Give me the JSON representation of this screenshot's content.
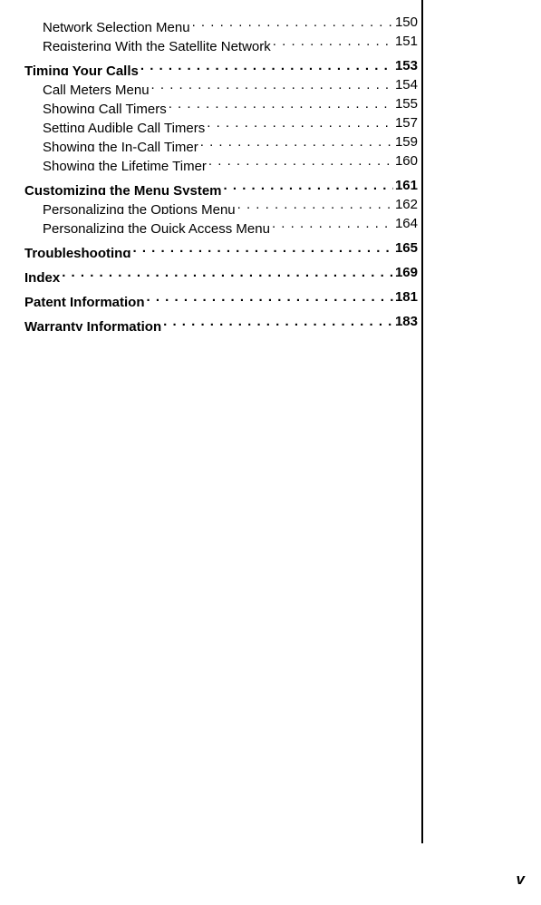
{
  "toc": [
    {
      "label": "Network Selection Menu",
      "page": "150",
      "sub": true,
      "bold": false,
      "continue": true
    },
    {
      "label": "Registering With the Satellite Network",
      "page": "151",
      "sub": true,
      "bold": false,
      "continue": true
    },
    {
      "label": "Timing Your Calls",
      "page": "153",
      "sub": false,
      "bold": true,
      "continue": false
    },
    {
      "label": "Call Meters Menu",
      "page": "154",
      "sub": true,
      "bold": false,
      "continue": true
    },
    {
      "label": "Showing Call Timers",
      "page": "155",
      "sub": true,
      "bold": false,
      "continue": true
    },
    {
      "label": "Setting Audible Call Timers",
      "page": "157",
      "sub": true,
      "bold": false,
      "continue": true
    },
    {
      "label": "Showing the In-Call Timer",
      "page": "159",
      "sub": true,
      "bold": false,
      "continue": true
    },
    {
      "label": "Showing the Lifetime Timer",
      "page": "160",
      "sub": true,
      "bold": false,
      "continue": true
    },
    {
      "label": "Customizing the Menu System",
      "page": "161",
      "sub": false,
      "bold": true,
      "continue": false
    },
    {
      "label": "Personalizing the Options Menu",
      "page": "162",
      "sub": true,
      "bold": false,
      "continue": true
    },
    {
      "label": "Personalizing the Quick Access Menu",
      "page": "164",
      "sub": true,
      "bold": false,
      "continue": true
    },
    {
      "label": "Troubleshooting",
      "page": "165",
      "sub": false,
      "bold": true,
      "continue": false
    },
    {
      "label": "Index",
      "page": " 169",
      "sub": false,
      "bold": true,
      "continue": false
    },
    {
      "label": "Patent Information",
      "page": "181",
      "sub": false,
      "bold": true,
      "continue": false
    },
    {
      "label": "Warranty Information",
      "page": "183",
      "sub": false,
      "bold": true,
      "continue": false
    }
  ],
  "pageNumber": "v",
  "dots": ". . . . . . . . . . . . . . . . . . . . . . . . . . . . . . . . . . . . . . . . . . . ."
}
